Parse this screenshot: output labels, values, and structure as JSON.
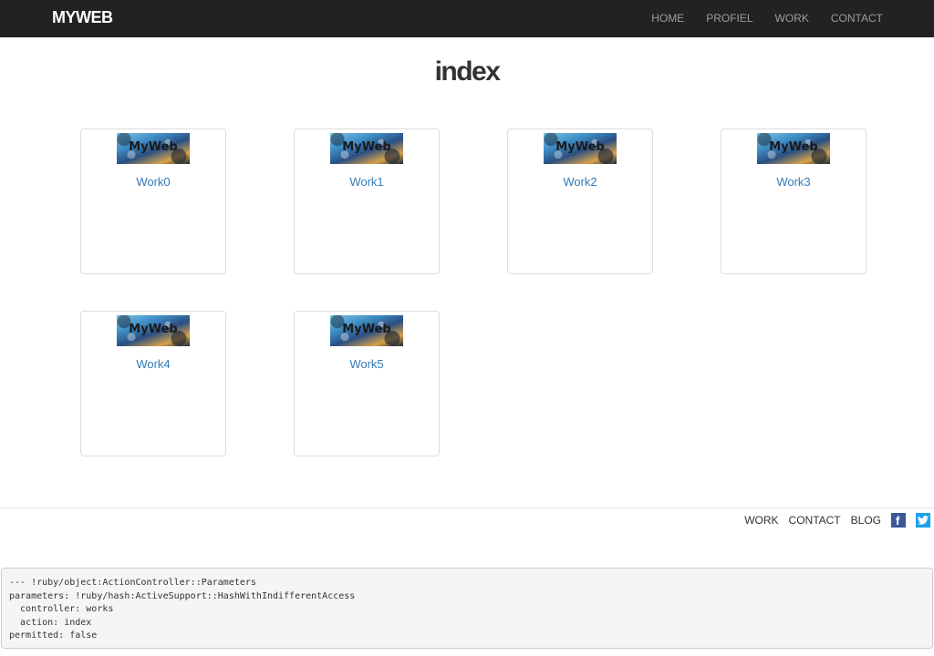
{
  "navbar": {
    "brand": "MYWEB",
    "links": [
      "HOME",
      "PROFIEL",
      "WORK",
      "CONTACT"
    ]
  },
  "page": {
    "title": "index"
  },
  "works": [
    {
      "label": "Work0",
      "thumb_text": "MyWeb"
    },
    {
      "label": "Work1",
      "thumb_text": "MyWeb"
    },
    {
      "label": "Work2",
      "thumb_text": "MyWeb"
    },
    {
      "label": "Work3",
      "thumb_text": "MyWeb"
    },
    {
      "label": "Work4",
      "thumb_text": "MyWeb"
    },
    {
      "label": "Work5",
      "thumb_text": "MyWeb"
    }
  ],
  "footer": {
    "links": [
      "WORK",
      "CONTACT",
      "BLOG"
    ],
    "icons": [
      "facebook-icon",
      "twitter-icon"
    ]
  },
  "debug": {
    "text": "--- !ruby/object:ActionController::Parameters\nparameters: !ruby/hash:ActiveSupport::HashWithIndifferentAccess\n  controller: works\n  action: index\npermitted: false"
  },
  "colors": {
    "navbar_bg": "#222222",
    "nav_link": "#9d9d9d",
    "link": "#337ab7",
    "facebook": "#3b5998",
    "twitter": "#1da1f2"
  }
}
